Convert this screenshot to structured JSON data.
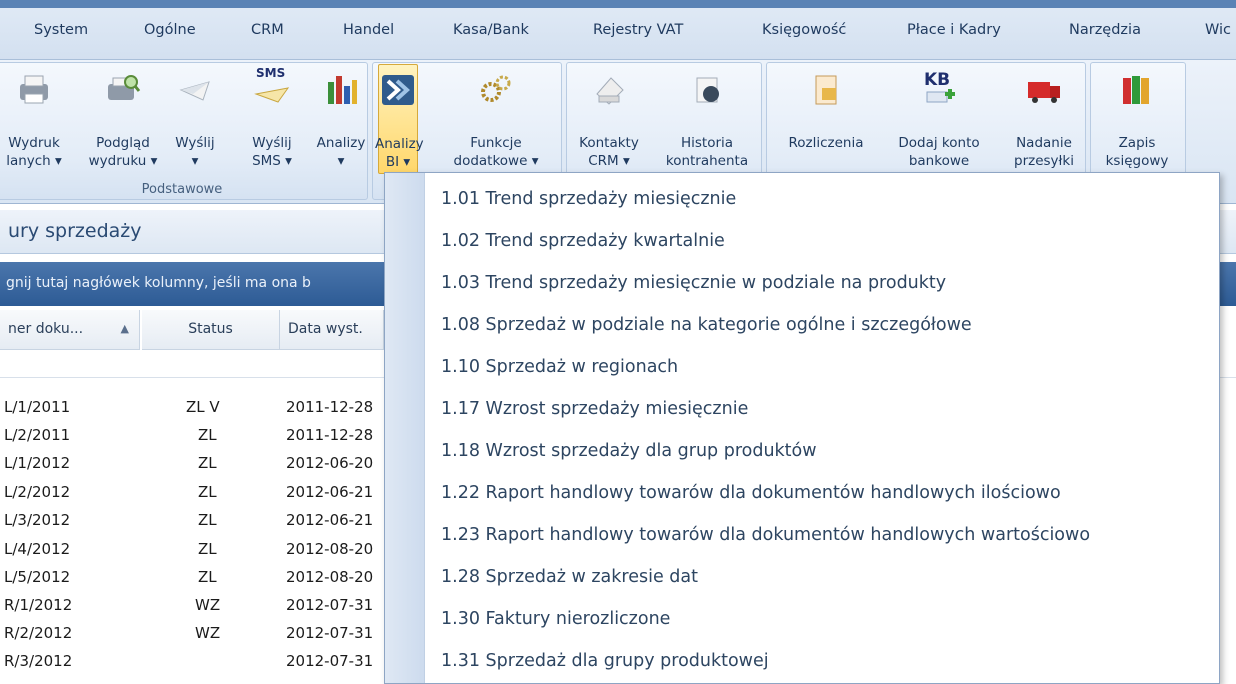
{
  "menubar": {
    "items": [
      "System",
      "Ogólne",
      "CRM",
      "Handel",
      "Kasa/Bank",
      "Rejestry VAT",
      "Księgowość",
      "Płace i Kadry",
      "Narzędzia",
      "Wic"
    ]
  },
  "ribbon": {
    "group1_label": "Podstawowe",
    "buttons": [
      {
        "label": "Wydruk\nlanych ▾",
        "icon": "printer-icon"
      },
      {
        "label": "Podgląd\nwydruku ▾",
        "icon": "print-preview-icon"
      },
      {
        "label": "Wyślij\n▾",
        "icon": "send-icon"
      },
      {
        "label": "Wyślij\nSMS ▾",
        "icon": "sms-icon"
      },
      {
        "label": "Analizy\n▾",
        "icon": "bar-chart-icon"
      },
      {
        "label": "Analizy\nBI ▾",
        "icon": "bi-analysis-icon"
      },
      {
        "label": "Funkcje\ndodatkowe ▾",
        "icon": "gears-icon"
      },
      {
        "label": "Kontakty\nCRM ▾",
        "icon": "contacts-icon"
      },
      {
        "label": "Historia\nkontrahenta",
        "icon": "history-icon"
      },
      {
        "label": "Rozliczenia",
        "icon": "settlements-icon"
      },
      {
        "label": "Dodaj konto\nbankowe",
        "icon": "add-bank-account-icon"
      },
      {
        "label": "Nadanie\nprzesyłki",
        "icon": "truck-icon"
      },
      {
        "label": "Zapis\nksięgowy",
        "icon": "books-icon"
      }
    ],
    "sms_badge": "SMS",
    "kb_badge": "KB"
  },
  "doc": {
    "title": "ury sprzedaży",
    "group_hint": "gnij tutaj nagłówek kolumny, jeśli ma ona b",
    "columns": [
      "ner doku...",
      "▲",
      "Status",
      "Data wyst."
    ]
  },
  "rows": [
    {
      "num": "L/1/2011",
      "status": "ZL V",
      "date": "2011-12-28"
    },
    {
      "num": "L/2/2011",
      "status": "ZL",
      "date": "2011-12-28"
    },
    {
      "num": "L/1/2012",
      "status": "ZL",
      "date": "2012-06-20"
    },
    {
      "num": "L/2/2012",
      "status": "ZL",
      "date": "2012-06-21"
    },
    {
      "num": "L/3/2012",
      "status": "ZL",
      "date": "2012-06-21"
    },
    {
      "num": "L/4/2012",
      "status": "ZL",
      "date": "2012-08-20"
    },
    {
      "num": "L/5/2012",
      "status": "ZL",
      "date": "2012-08-20"
    },
    {
      "num": "R/1/2012",
      "status": "WZ",
      "date": "2012-07-31"
    },
    {
      "num": "R/2/2012",
      "status": "WZ",
      "date": "2012-07-31"
    },
    {
      "num": "R/3/2012",
      "status": "",
      "date": "2012-07-31"
    }
  ],
  "dropdown": {
    "items": [
      "1.01 Trend sprzedaży miesięcznie",
      "1.02 Trend sprzedaży kwartalnie",
      "1.03 Trend sprzedaży miesięcznie w podziale na produkty",
      "1.08 Sprzedaż w podziale na kategorie ogólne i szczegółowe",
      "1.10 Sprzedaż w regionach",
      "1.17 Wzrost sprzedaży miesięcznie",
      "1.18 Wzrost sprzedaży dla grup produktów",
      "1.22 Raport handlowy towarów dla dokumentów handlowych ilościowo",
      "1.23 Raport handlowy towarów dla dokumentów handlowych wartościowo",
      "1.28 Sprzedaż w zakresie dat",
      "1.30 Faktury nierozliczone",
      "1.31 Sprzedaż dla grupy produktowej"
    ]
  },
  "colors": {
    "accent": "#2d5b95",
    "active_button": "#ffd76b"
  }
}
